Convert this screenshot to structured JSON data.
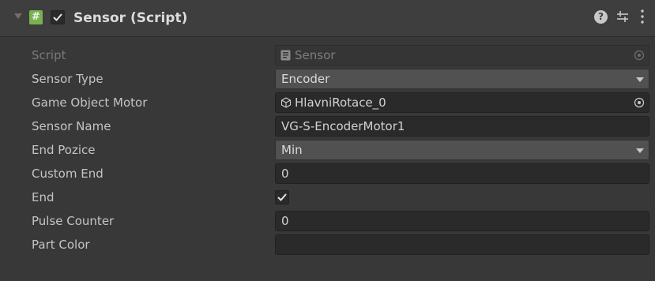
{
  "component": {
    "title": "Sensor (Script)",
    "enabled": true,
    "script_icon_glyph": "#",
    "help_glyph": "?",
    "icons": {
      "foldout": "foldout-expanded-icon",
      "script": "csharp-script-icon",
      "help": "help-icon",
      "presets": "presets-sliders-icon",
      "menu": "kebab-menu-icon"
    }
  },
  "fields": {
    "script": {
      "label": "Script",
      "value": "Sensor"
    },
    "sensor_type": {
      "label": "Sensor Type",
      "value": "Encoder"
    },
    "game_object_motor": {
      "label": "Game Object Motor",
      "value": "HlavniRotace_0"
    },
    "sensor_name": {
      "label": "Sensor Name",
      "value": "VG-S-EncoderMotor1"
    },
    "end_pozice": {
      "label": "End Pozice",
      "value": "Min"
    },
    "custom_end": {
      "label": "Custom End",
      "value": "0"
    },
    "end": {
      "label": "End",
      "checked": true
    },
    "pulse_counter": {
      "label": "Pulse Counter",
      "value": "0"
    },
    "part_color": {
      "label": "Part Color",
      "value": ""
    }
  },
  "colors": {
    "background": "#383838",
    "header": "#3e3e3e",
    "text_field": "#2a2a2a",
    "popup": "#515151",
    "script_icon": "#77b24d",
    "label_text": "#c4c4c4"
  }
}
